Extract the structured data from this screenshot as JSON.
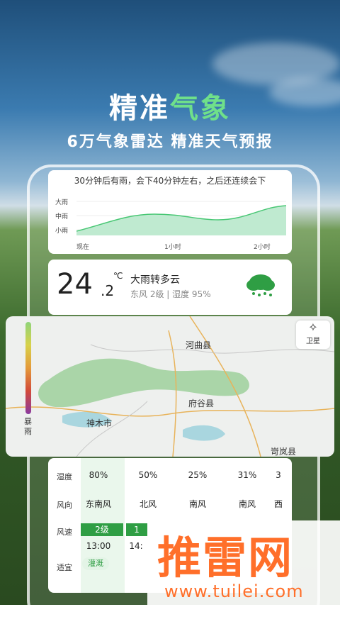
{
  "hero": {
    "title_main": "精准",
    "title_accent": "气象",
    "subtitle": "6万气象雷达  精准天气预报"
  },
  "rain_forecast": {
    "summary": "30分钟后有雨，会下40分钟左右，之后还连续会下",
    "levels": [
      "大雨",
      "中雨",
      "小雨"
    ],
    "times": [
      "现在",
      "1小时",
      "2小时"
    ]
  },
  "current": {
    "temp_int": "24",
    "temp_dec": ".2",
    "unit": "℃",
    "condition": "大雨转多云",
    "details": "东风 2级 | 湿度 95%",
    "icon": "rain-cloud-icon"
  },
  "radar": {
    "legend_label": "暴雨",
    "satellite_label": "卫星",
    "places": [
      "河曲县",
      "府谷县",
      "神木市",
      "岢岚县"
    ]
  },
  "hourly_table": {
    "labels": [
      "湿度",
      "风向",
      "风速",
      "适宜"
    ],
    "humidity": [
      "80%",
      "50%",
      "25%",
      "31%",
      "3"
    ],
    "wind_dir": [
      "东南风",
      "北风",
      "南风",
      "南风",
      "西"
    ],
    "wind_level": [
      "2级",
      "1"
    ],
    "time": [
      "13:00",
      "14:"
    ],
    "suitable": "灌溉"
  },
  "watermark": {
    "brand": "推雷网",
    "url": "www.tuilei.com"
  },
  "colors": {
    "accent_green": "#6fe08a",
    "badge_green": "#2f9e44",
    "watermark_orange": "#ff6f2a"
  }
}
